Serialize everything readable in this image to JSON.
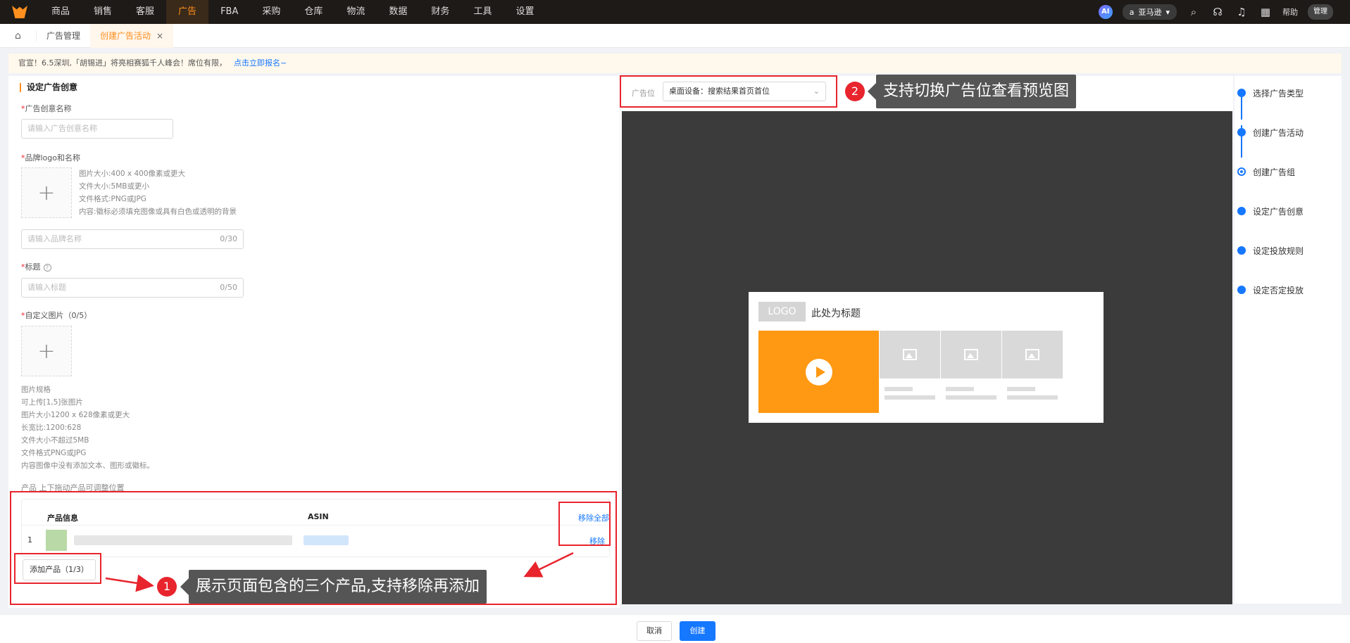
{
  "nav": {
    "items": [
      "商品",
      "销售",
      "客服",
      "广告",
      "FBA",
      "采购",
      "仓库",
      "物流",
      "数据",
      "财务",
      "工具",
      "设置"
    ],
    "active_index": 3,
    "ai_label": "AI",
    "store": "亚马逊",
    "help": "帮助",
    "user": "管理"
  },
  "tabs": {
    "items": [
      {
        "label": "广告管理",
        "active": false
      },
      {
        "label": "创建广告活动",
        "active": true
      }
    ],
    "close_glyph": "×"
  },
  "notice": {
    "text": "官宣！6.5深圳,「胡锡进」将亮相赛狐千人峰会！席位有限，",
    "link": "点击立即报名~"
  },
  "form": {
    "section_title": "设定广告创意",
    "creative_name_label": "广告创意名称",
    "creative_name_placeholder": "请输入广告创意名称",
    "brand_label": "品牌logo和名称",
    "brand_hints": [
      "图片大小:400 x 400像素或更大",
      "文件大小:5MB或更小",
      "文件格式:PNG或JPG",
      "内容:徽标必须填充图像或具有白色或透明的背景"
    ],
    "brand_name_placeholder": "请输入品牌名称",
    "brand_name_counter": "0/30",
    "headline_label": "标题",
    "headline_placeholder": "请输入标题",
    "headline_counter": "0/50",
    "custom_image_label": "自定义图片（0/5）",
    "image_spec_title": "图片规格",
    "image_specs": [
      "可上传[1,5]张图片",
      "图片大小1200 x 628像素或更大",
      "长宽比:1200:628",
      "文件大小不超过5MB",
      "文件格式PNG或JPG",
      "内容图像中没有添加文本、图形或徽标。"
    ],
    "products_label": "产品  上下拖动产品可调整位置",
    "col_product": "产品信息",
    "col_asin": "ASIN",
    "remove_all": "移除全部",
    "row_index": "1",
    "remove": "移除",
    "add_product": "添加产品（1/3）",
    "upload_plus": "+",
    "required_mark": "*",
    "help_glyph": "?"
  },
  "preview": {
    "position_label": "广告位",
    "position_value": "桌面设备：搜索结果首页首位",
    "caret": "⌄",
    "logo_text": "LOGO",
    "title_placeholder": "此处为标题"
  },
  "steps": {
    "items": [
      "选择广告类型",
      "创建广告活动",
      "创建广告组",
      "设定广告创意",
      "设定投放规则",
      "设定否定投放"
    ],
    "current_index": 2
  },
  "footer": {
    "cancel": "取消",
    "create": "创建"
  },
  "annotations": {
    "badge_1": "1",
    "callout_1": "展示页面包含的三个产品,支持移除再添加",
    "badge_2": "2",
    "callout_2": "支持切换广告位查看预览图",
    "color": "#e8242d"
  },
  "colors": {
    "accent": "#ff8f1f",
    "primary": "#1677ff",
    "preview_bg": "#3b3b3b",
    "video_placeholder": "#ff9812"
  },
  "icons": {
    "home": "home-icon",
    "search": "search-icon",
    "headset": "headset-icon",
    "bell": "bell-icon",
    "grid": "grid-icon",
    "amazon": "amazon-icon",
    "dropdown": "chevron-down-icon"
  }
}
